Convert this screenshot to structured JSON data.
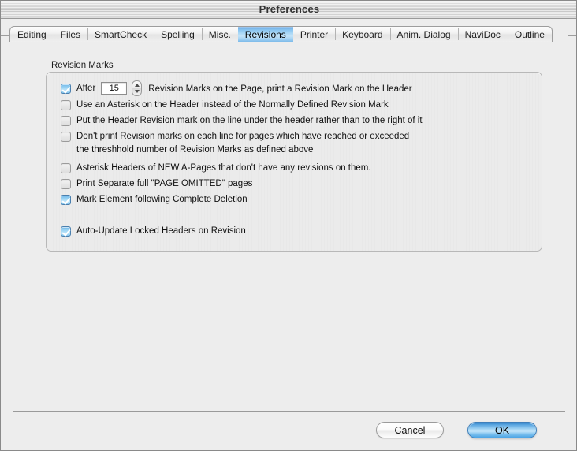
{
  "window": {
    "title": "Preferences"
  },
  "tabs": [
    {
      "label": "Editing",
      "active": false
    },
    {
      "label": "Files",
      "active": false
    },
    {
      "label": "SmartCheck",
      "active": false
    },
    {
      "label": "Spelling",
      "active": false
    },
    {
      "label": "Misc.",
      "active": false
    },
    {
      "label": "Revisions",
      "active": true
    },
    {
      "label": "Printer",
      "active": false
    },
    {
      "label": "Keyboard",
      "active": false
    },
    {
      "label": "Anim. Dialog",
      "active": false
    },
    {
      "label": "NaviDoc",
      "active": false
    },
    {
      "label": "Outline",
      "active": false
    }
  ],
  "group": {
    "label": "Revision Marks"
  },
  "options": {
    "after_row": {
      "checked": true,
      "prefix": "After",
      "value": "15",
      "suffix": "Revision Marks on the Page, print a Revision Mark on the Header",
      "stepper_up": "increment",
      "stepper_down": "decrement"
    },
    "items": [
      {
        "checked": false,
        "label": "Use an Asterisk on the Header instead of the Normally Defined Revision Mark",
        "continuation": ""
      },
      {
        "checked": false,
        "label": "Put the Header Revision mark on the line under the header rather than to the right of it",
        "continuation": ""
      },
      {
        "checked": false,
        "label": "Don't print Revision marks on each line for pages which have reached or exceeded",
        "continuation": "the threshhold number of Revision Marks as defined above"
      },
      {
        "checked": false,
        "label": "Asterisk Headers of NEW A-Pages that don't have any revisions on them.",
        "continuation": ""
      },
      {
        "checked": false,
        "label": "Print Separate full \"PAGE OMITTED\" pages",
        "continuation": ""
      },
      {
        "checked": true,
        "label": "Mark Element following Complete Deletion",
        "continuation": ""
      },
      {
        "checked": true,
        "label": "Auto-Update Locked Headers on Revision",
        "continuation": ""
      }
    ]
  },
  "buttons": {
    "cancel": "Cancel",
    "ok": "OK"
  },
  "colors": {
    "accent_blue": "#5fa9e2",
    "active_tab_blue": "#a9d7f6",
    "window_bg": "#ededed",
    "group_border": "#b8b8b8"
  }
}
